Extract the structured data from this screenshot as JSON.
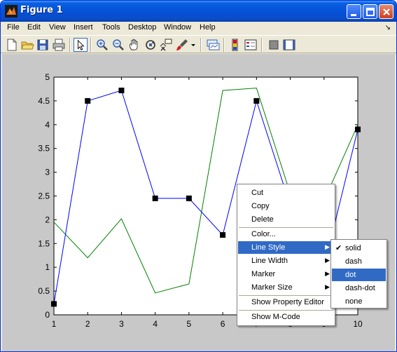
{
  "window": {
    "title": "Figure 1"
  },
  "menu": [
    "File",
    "Edit",
    "View",
    "Insert",
    "Tools",
    "Desktop",
    "Window",
    "Help"
  ],
  "toolbar": {
    "tools": [
      "new-figure-icon",
      "open-file-icon",
      "save-icon",
      "print-icon",
      "edit-plot-icon",
      "zoom-in-icon",
      "zoom-out-icon",
      "pan-icon",
      "rotate-3d-icon",
      "data-cursor-icon",
      "brush-icon",
      "brush-dropdown-icon",
      "link-plot-icon",
      "colorbar-icon",
      "legend-icon",
      "hide-plot-tools-icon",
      "show-plot-tools-icon"
    ]
  },
  "chart_data": {
    "type": "line",
    "x": [
      1,
      2,
      3,
      4,
      5,
      6,
      7,
      8,
      9,
      10
    ],
    "xlim": [
      1,
      10
    ],
    "ylim": [
      0,
      5
    ],
    "xticks": [
      "1",
      "2",
      "3",
      "4",
      "5",
      "6",
      "7",
      "8",
      "9",
      "10"
    ],
    "yticks": [
      "0",
      "0.5",
      "1",
      "1.5",
      "2",
      "2.5",
      "3",
      "3.5",
      "4",
      "4.5",
      "5"
    ],
    "grid": false,
    "series": [
      {
        "color": "#0000ff",
        "marker": "square",
        "values": [
          0.23,
          4.5,
          4.72,
          2.45,
          2.45,
          1.68,
          4.5,
          2.3,
          1.0,
          3.9
        ]
      },
      {
        "color": "#008000",
        "marker": "none",
        "values": [
          1.95,
          1.2,
          2.02,
          0.46,
          0.65,
          4.72,
          4.77,
          2.55,
          2.4,
          4.0
        ]
      }
    ]
  },
  "context_menu": {
    "items": [
      "Cut",
      "Copy",
      "Delete",
      "Color...",
      "Line Style",
      "Line Width",
      "Marker",
      "Marker Size",
      "Show Property Editor",
      "Show M-Code"
    ],
    "highlighted": "Line Style"
  },
  "submenu": {
    "items": [
      "solid",
      "dash",
      "dot",
      "dash-dot",
      "none"
    ],
    "checked": "solid",
    "highlighted": "dot"
  }
}
